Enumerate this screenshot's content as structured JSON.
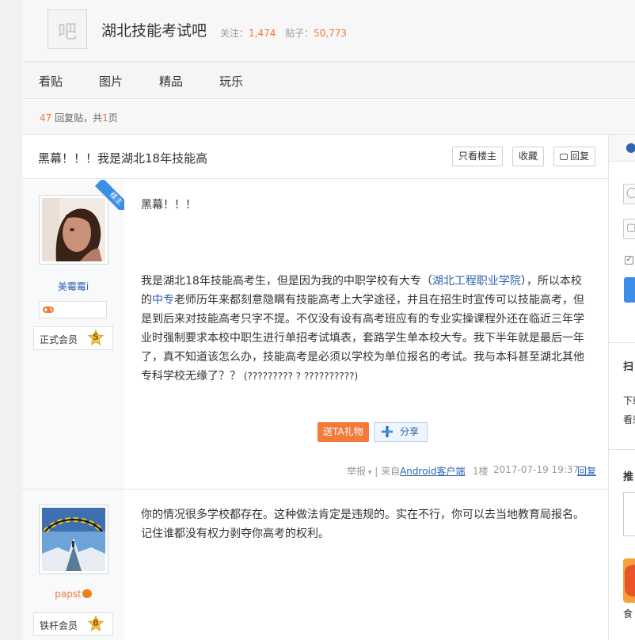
{
  "forum": {
    "logo_char": "吧",
    "name": "湖北技能考试吧",
    "follow_label": "关注：",
    "follow_count": "1,474",
    "posts_label": "贴子：",
    "posts_count": "50,773"
  },
  "nav": [
    "看贴",
    "图片",
    "精品",
    "玩乐"
  ],
  "replies": {
    "count": "47",
    "label": " 回复贴，共",
    "pages": "1",
    "pages_suffix": "页"
  },
  "thread": {
    "title": "黑幕！！！我是湖北18年技能高",
    "btn_op_only": "只看楼主",
    "btn_fav": "收藏",
    "btn_reply": "回复"
  },
  "posts": [
    {
      "badge": "楼主",
      "username": "美霉霉i",
      "rank": "正式会员",
      "level": "5",
      "title_line": "黑幕！！！",
      "body_1": "我是湖北18年技能高考生，但是因为我的中职学校有大专（",
      "link_1": "湖北工程职业学院",
      "body_2": "），所以本校的",
      "link_2": "中专",
      "body_3": "老师历年来都刻意隐瞒有技能高考上大学途径，并且在招生时宣传可以技能高考，但是到后来对技能高考只字不提。不仅没有设有高考班应有的专业实操课程外还在临近三年学业时强制要求本校中职生进行单招考试填表，套路学生单本校大专。我下半年就是最后一年了，真不知道该怎么办，技能高考是必须以学校为单位报名的考试。我与本科甚至湖北其他专科学校无缘了？？",
      "body_suffix": " (????????? ? ??????????)",
      "gift_btn": "送TA礼物",
      "share_btn": "分享",
      "report": "举报",
      "from_prefix": " | 来自",
      "client": "Android客户端",
      "floor": "1楼",
      "time": "2017-07-19 19:37",
      "reply": "回复"
    },
    {
      "username": "papst",
      "rank": "铁杆会员",
      "level": "8",
      "body": "你的情况很多学校都存在。这种做法肯定是违规的。实在不行，你可以去当地教育局报名。记住谁都没有权力剥夺你高考的权利。"
    }
  ],
  "sidebar": {
    "paw_icon": "paw-icon",
    "scan": "扫",
    "down": "下载",
    "look": "看惹",
    "rec": "推",
    "food": "食"
  },
  "colors": {
    "accent": "#f07a3c",
    "link": "#2d64b3",
    "blue": "#3d8ee8"
  }
}
